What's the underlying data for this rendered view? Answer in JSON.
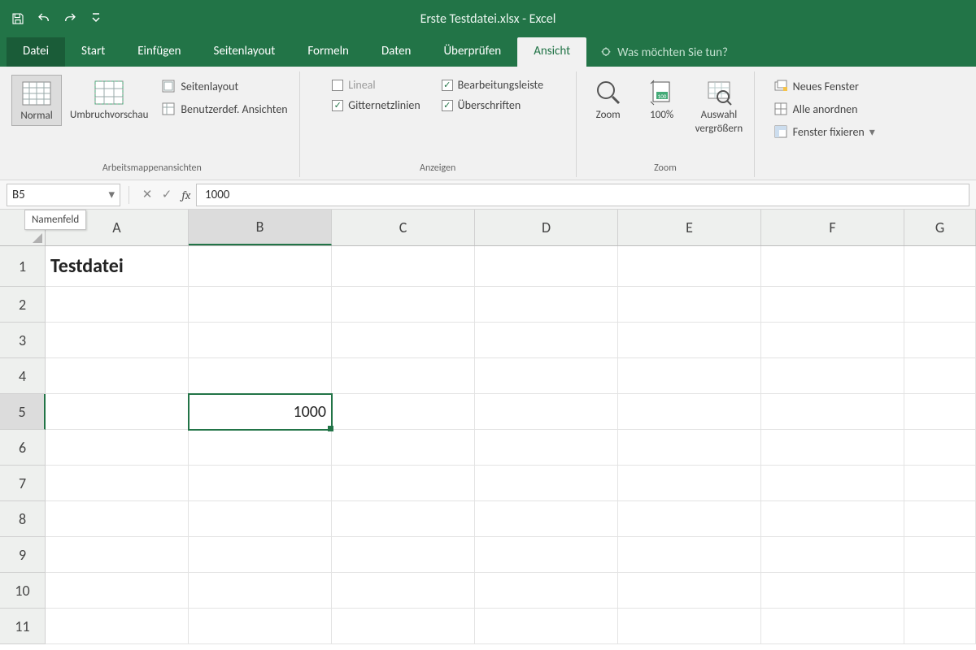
{
  "title": "Erste Testdatei.xlsx - Excel",
  "tabs": {
    "file": "Datei",
    "items": [
      "Start",
      "Einfügen",
      "Seitenlayout",
      "Formeln",
      "Daten",
      "Überprüfen",
      "Ansicht"
    ],
    "active": "Ansicht",
    "tell_me": "Was möchten Sie tun?"
  },
  "ribbon": {
    "views": {
      "normal": "Normal",
      "page_break": "Umbruchvorschau",
      "page_layout": "Seitenlayout",
      "custom_views": "Benutzerdef. Ansichten",
      "group": "Arbeitsmappenansichten"
    },
    "show": {
      "ruler": {
        "label": "Lineal",
        "checked": false,
        "disabled": true
      },
      "formula_bar": {
        "label": "Bearbeitungsleiste",
        "checked": true
      },
      "gridlines": {
        "label": "Gitternetzlinien",
        "checked": true
      },
      "headings": {
        "label": "Überschriften",
        "checked": true
      },
      "group": "Anzeigen"
    },
    "zoom": {
      "zoom": "Zoom",
      "hundred": "100%",
      "to_selection_l1": "Auswahl",
      "to_selection_l2": "vergrößern",
      "group": "Zoom"
    },
    "window": {
      "new_window": "Neues Fenster",
      "arrange_all": "Alle anordnen",
      "freeze_panes": "Fenster fixieren"
    }
  },
  "formula_bar": {
    "name_box": "B5",
    "name_box_tooltip": "Namenfeld",
    "value": "1000"
  },
  "sheet": {
    "columns": [
      "A",
      "B",
      "C",
      "D",
      "E",
      "F",
      "G"
    ],
    "rows": [
      1,
      2,
      3,
      4,
      5,
      6,
      7,
      8,
      9,
      10,
      11
    ],
    "active_cell": "B5",
    "cells": {
      "A1": "Testdatei",
      "B5": "1000"
    }
  }
}
